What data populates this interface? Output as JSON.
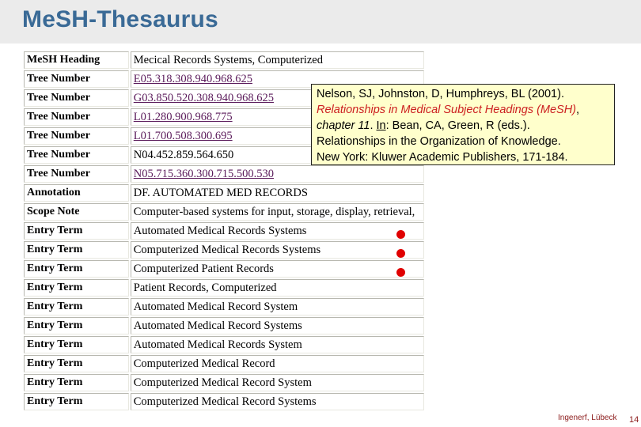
{
  "slide": {
    "title": "MeSH-Thesaurus",
    "footer": "Ingenerf, Lübeck",
    "page_number": "14"
  },
  "table": {
    "rows": [
      {
        "label": "MeSH Heading",
        "value": "Mecical Records Systems, Computerized",
        "link": false,
        "marked": false
      },
      {
        "label": "Tree Number",
        "value": "E05.318.308.940.968.625",
        "link": true,
        "marked": false
      },
      {
        "label": "Tree Number",
        "value": "G03.850.520.308.940.968.625",
        "link": true,
        "marked": false
      },
      {
        "label": "Tree Number",
        "value": "L01.280.900.968.775",
        "link": true,
        "marked": false
      },
      {
        "label": "Tree Number",
        "value": "L01.700.508.300.695",
        "link": true,
        "marked": false
      },
      {
        "label": "Tree Number",
        "value": "N04.452.859.564.650",
        "link": false,
        "marked": false
      },
      {
        "label": "Tree Number",
        "value": "N05.715.360.300.715.500.530",
        "link": true,
        "marked": false
      },
      {
        "label": "Annotation",
        "value": "DF. AUTOMATED MED RECORDS",
        "link": false,
        "marked": false
      },
      {
        "label": "Scope Note",
        "value": "Computer-based systems for input, storage, display, retrieval,",
        "link": false,
        "marked": false
      },
      {
        "label": "Entry Term",
        "value": "Automated Medical Records Systems",
        "link": false,
        "marked": true
      },
      {
        "label": "Entry Term",
        "value": "Computerized Medical Records Systems",
        "link": false,
        "marked": true
      },
      {
        "label": "Entry Term",
        "value": "Computerized Patient Records",
        "link": false,
        "marked": true
      },
      {
        "label": "Entry Term",
        "value": "Patient Records, Computerized",
        "link": false,
        "marked": false
      },
      {
        "label": "Entry Term",
        "value": "Automated Medical Record System",
        "link": false,
        "marked": false
      },
      {
        "label": "Entry Term",
        "value": "Automated Medical Record Systems",
        "link": false,
        "marked": false
      },
      {
        "label": "Entry Term",
        "value": "Automated Medical Records System",
        "link": false,
        "marked": false
      },
      {
        "label": "Entry Term",
        "value": "Computerized Medical Record",
        "link": false,
        "marked": false
      },
      {
        "label": "Entry Term",
        "value": "Computerized Medical Record System",
        "link": false,
        "marked": false
      },
      {
        "label": "Entry Term",
        "value": "Computerized Medical Record Systems",
        "link": false,
        "marked": false
      }
    ]
  },
  "citation": {
    "line1": "Nelson, SJ, Johnston, D, Humphreys, BL (2001).",
    "title_red": "Relationships in Medical Subject Headings (MeSH)",
    "title_comma": ",",
    "chapter": "chapter 11",
    "period": ". ",
    "in_label": "In",
    "editors": ": Bean, CA, Green, R (eds.).",
    "book": "Relationships in the Organization of Knowledge.",
    "publisher": "New York: Kluwer Academic Publishers, 171-184."
  },
  "colors": {
    "title": "#3a6a96",
    "link": "#5a1a5a",
    "marker": "#e00000",
    "citation_bg": "#ffffcc",
    "citation_accent": "#cc2020",
    "footer": "#8b1a1a"
  }
}
